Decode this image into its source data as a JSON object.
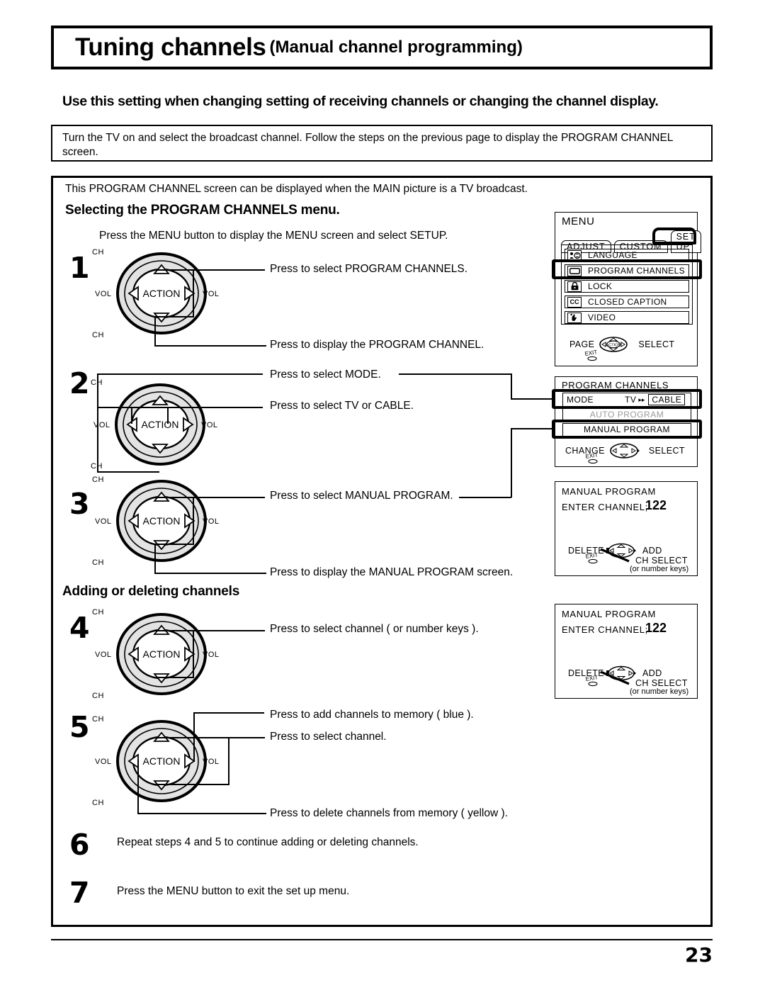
{
  "header": {
    "title_main": "Tuning channels",
    "title_sub": "(Manual channel programming)",
    "lead": "Use this setting when changing setting of receiving channels or changing the channel display.",
    "intro": "Turn the TV on and select the broadcast channel. Follow the steps on the previous page to display the PROGRAM CHANNEL screen."
  },
  "body": {
    "note": "This PROGRAM CHANNEL screen can be displayed when the MAIN picture is a TV broadcast.",
    "section_1_heading": "Selecting the PROGRAM CHANNELS  menu.",
    "section_1_note": "Press the MENU button to display the MENU screen and select SETUP.",
    "section_2_heading": "Adding or deleting channels"
  },
  "steps": [
    {
      "num": "1",
      "callouts": [
        "Press to select PROGRAM CHANNELS.",
        "Press to display the PROGRAM CHANNEL."
      ]
    },
    {
      "num": "2",
      "callouts": [
        "Press to select MODE.",
        "Press to select TV or CABLE."
      ]
    },
    {
      "num": "3",
      "callouts": [
        "Press to select MANUAL PROGRAM.",
        "Press to display the MANUAL PROGRAM screen."
      ]
    },
    {
      "num": "4",
      "callouts": [
        "Press to select channel ( or number keys )."
      ]
    },
    {
      "num": "5",
      "callouts": [
        "Press to add channels to memory ( blue ).",
        "Press to select channel.",
        "Press to delete channels from memory ( yellow )."
      ]
    },
    {
      "num": "6",
      "text": "Repeat steps 4 and 5 to continue adding or deleting channels."
    },
    {
      "num": "7",
      "text": "Press the MENU button to exit the set up menu."
    }
  ],
  "dial": {
    "center_label": "ACTION",
    "top_label": "CH",
    "bottom_label": "CH",
    "left_label": "VOL",
    "right_label": "VOL"
  },
  "osd_menu": {
    "title": "MENU",
    "tabs": [
      {
        "label": "ADJUST",
        "selected": false
      },
      {
        "label": "CUSTOM",
        "selected": false
      },
      {
        "label": "SET UP",
        "selected": true
      }
    ],
    "items": [
      {
        "icon": "person-speech-icon",
        "label": "LANGUAGE",
        "selected": false
      },
      {
        "icon": "tv-screen-icon",
        "label": "PROGRAM  CHANNELS",
        "selected": true
      },
      {
        "icon": "padlock-icon",
        "label": "LOCK",
        "selected": false
      },
      {
        "icon": "closed-caption-icon",
        "label": "CLOSED  CAPTION",
        "selected": false
      },
      {
        "icon": "hand-pointer-icon",
        "label": "VIDEO",
        "selected": false
      }
    ],
    "nav_left": "PAGE",
    "nav_right": "SELECT",
    "nav_exit": "EXIT",
    "nav_center": "ACTION"
  },
  "osd_program_channels": {
    "title": "PROGRAM  CHANNELS",
    "mode_label": "MODE",
    "mode_option_tv": "TV",
    "mode_option_cable": "CABLE",
    "mode_selected": "CABLE",
    "auto_program": "AUTO  PROGRAM",
    "manual_program": "MANUAL  PROGRAM",
    "nav_left": "CHANGE",
    "nav_right": "SELECT",
    "nav_exit": "EXIT",
    "nav_center": "ACTION"
  },
  "osd_manual_program": {
    "title": "MANUAL  PROGRAM",
    "enter_channel_label": "ENTER  CHANNEL;",
    "enter_channel_value": "122",
    "nav_left": "DELETE",
    "nav_right": "ADD",
    "nav_down": "CH SELECT",
    "nav_down_note": "(or number keys)",
    "nav_exit": "EXIT"
  },
  "footer": {
    "page_number": "23"
  },
  "colors": {
    "ink": "#000000",
    "paper": "#ffffff",
    "dial_fill": "#e3e3e3",
    "dial_inner": "#ffffff"
  }
}
